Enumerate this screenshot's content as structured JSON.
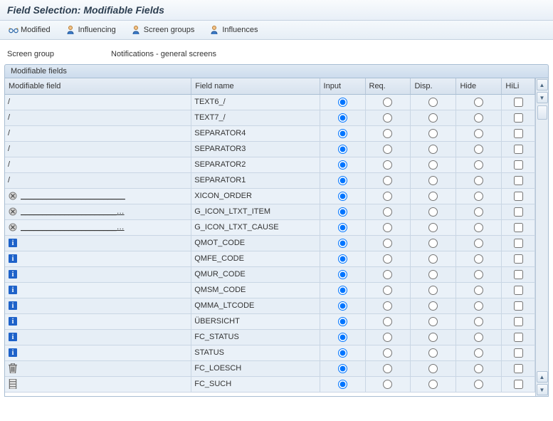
{
  "title": "Field Selection: Modifiable Fields",
  "toolbar": {
    "modified": "Modified",
    "influencing": "Influencing",
    "screen_groups": "Screen groups",
    "influences": "Influences"
  },
  "screen_group": {
    "label": "Screen group",
    "value": "Notifications - general screens"
  },
  "panel_title": "Modifiable fields",
  "columns": {
    "modifiable_field": "Modifiable field",
    "field_name": "Field name",
    "input": "Input",
    "req": "Req.",
    "disp": "Disp.",
    "hide": "Hide",
    "hili": "HiLi"
  },
  "rows": [
    {
      "icon": null,
      "mod_text": "/",
      "mod_under": "",
      "field": "TEXT6_/",
      "sel": "input"
    },
    {
      "icon": null,
      "mod_text": "/",
      "mod_under": "",
      "field": "TEXT7_/",
      "sel": "input"
    },
    {
      "icon": null,
      "mod_text": "/",
      "mod_under": "",
      "field": "SEPARATOR4",
      "sel": "input"
    },
    {
      "icon": null,
      "mod_text": "/",
      "mod_under": "",
      "field": "SEPARATOR3",
      "sel": "input"
    },
    {
      "icon": null,
      "mod_text": "/",
      "mod_under": "",
      "field": "SEPARATOR2",
      "sel": "input"
    },
    {
      "icon": null,
      "mod_text": "/",
      "mod_under": "",
      "field": "SEPARATOR1",
      "sel": "input"
    },
    {
      "icon": "cancel",
      "mod_text": "",
      "mod_under": "________________________",
      "field": "XICON_ORDER",
      "sel": "input"
    },
    {
      "icon": "cancel",
      "mod_text": "",
      "mod_under": "______________________…",
      "field": "G_ICON_LTXT_ITEM",
      "sel": "input"
    },
    {
      "icon": "cancel",
      "mod_text": "",
      "mod_under": "______________________…",
      "field": "G_ICON_LTXT_CAUSE",
      "sel": "input"
    },
    {
      "icon": "info",
      "mod_text": "",
      "mod_under": "",
      "field": "QMOT_CODE",
      "sel": "input"
    },
    {
      "icon": "info",
      "mod_text": "",
      "mod_under": "",
      "field": "QMFE_CODE",
      "sel": "input"
    },
    {
      "icon": "info",
      "mod_text": "",
      "mod_under": "",
      "field": "QMUR_CODE",
      "sel": "input"
    },
    {
      "icon": "info",
      "mod_text": "",
      "mod_under": "",
      "field": "QMSM_CODE",
      "sel": "input"
    },
    {
      "icon": "info",
      "mod_text": "",
      "mod_under": "",
      "field": "QMMA_LTCODE",
      "sel": "input"
    },
    {
      "icon": "info",
      "mod_text": "",
      "mod_under": "",
      "field": "ÜBERSICHT",
      "sel": "input"
    },
    {
      "icon": "info",
      "mod_text": "",
      "mod_under": "",
      "field": "FC_STATUS",
      "sel": "input"
    },
    {
      "icon": "info",
      "mod_text": "",
      "mod_under": "",
      "field": "STATUS",
      "sel": "input"
    },
    {
      "icon": "trash",
      "mod_text": "",
      "mod_under": "",
      "field": "FC_LOESCH",
      "sel": "input"
    },
    {
      "icon": "history",
      "mod_text": "",
      "mod_under": "",
      "field": "FC_SUCH",
      "sel": "input"
    }
  ]
}
